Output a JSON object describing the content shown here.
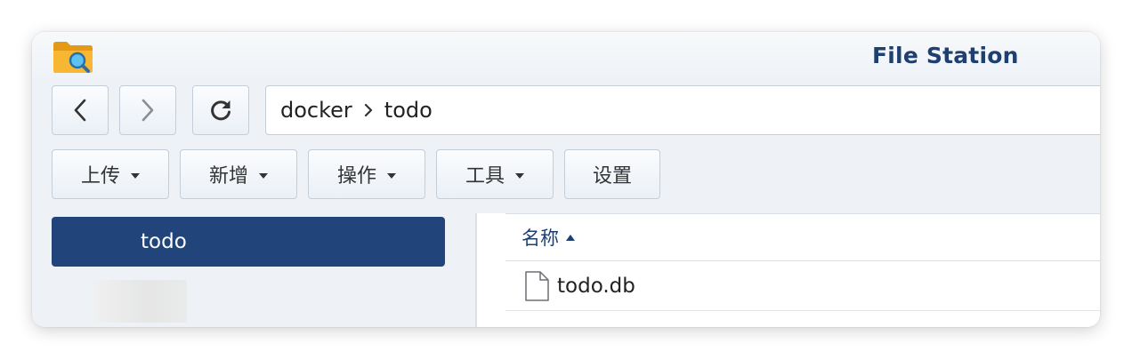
{
  "app": {
    "title": "File Station",
    "icon": "folder-search-icon"
  },
  "nav": {
    "back_icon": "chevron-left-icon",
    "forward_icon": "chevron-right-icon",
    "refresh_icon": "refresh-icon"
  },
  "path": {
    "crumbs": [
      "docker",
      "todo"
    ],
    "separator_icon": "chevron-right-icon"
  },
  "toolbar": {
    "upload_label": "上传",
    "new_label": "新增",
    "action_label": "操作",
    "tools_label": "工具",
    "settings_label": "设置"
  },
  "tree": {
    "selected_label": "todo"
  },
  "file_list": {
    "columns": [
      {
        "label": "名称",
        "sort": "asc"
      }
    ],
    "rows": [
      {
        "name": "todo.db",
        "icon": "file-icon"
      }
    ]
  },
  "colors": {
    "title": "#1e3f6f",
    "selected_bg": "#21457a",
    "window_bg": "#eef2f7"
  }
}
